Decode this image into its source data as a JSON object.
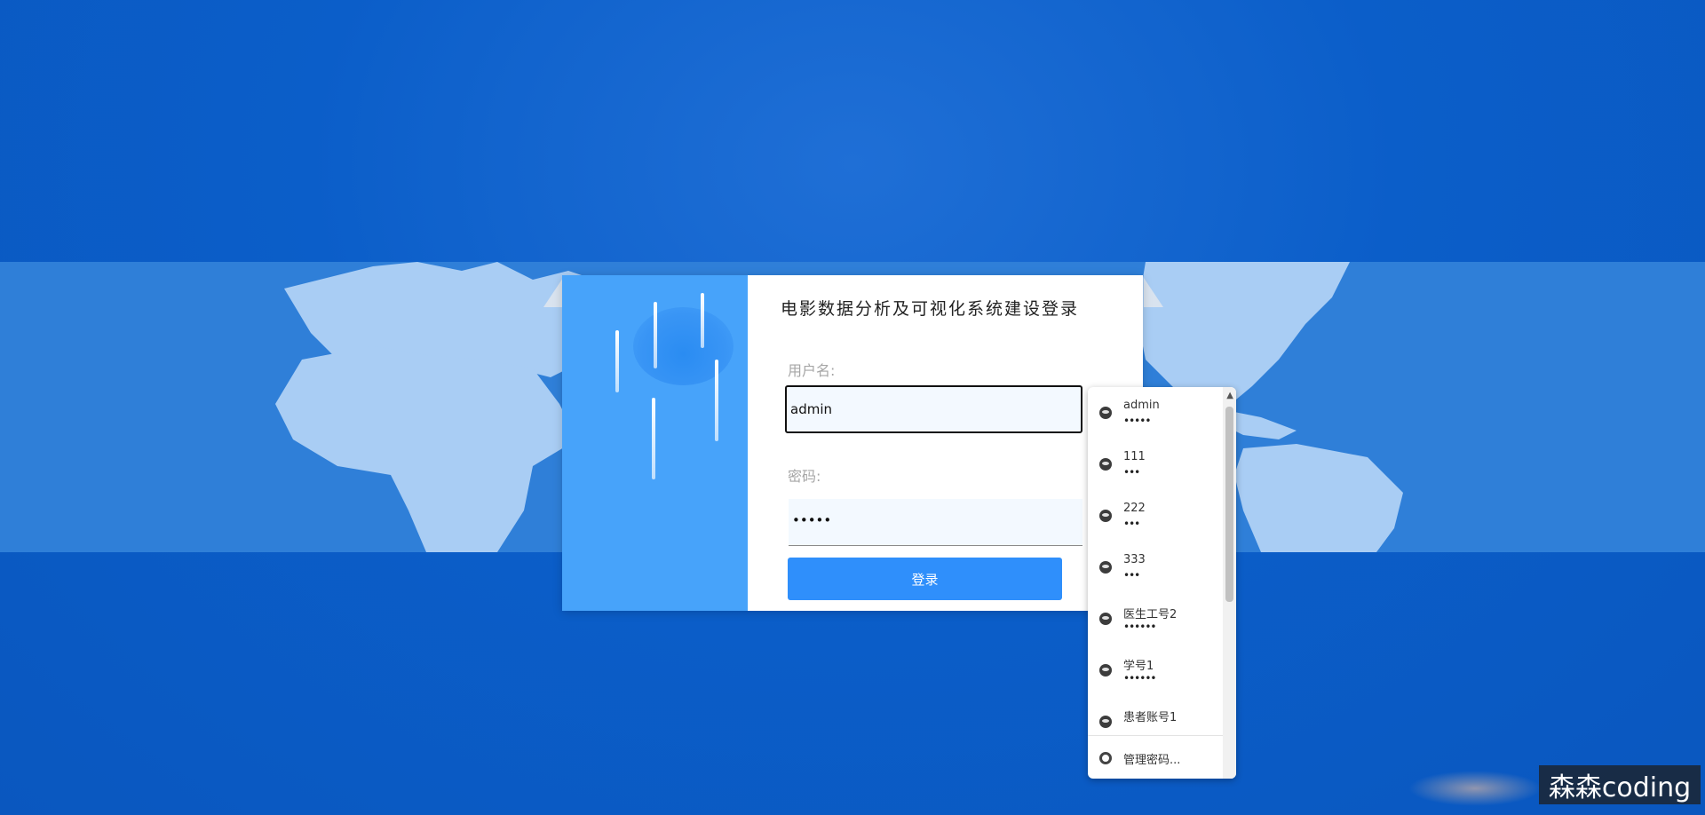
{
  "login": {
    "title": "电影数据分析及可视化系统建设登录",
    "username_label": "用户名:",
    "username_value": "admin",
    "password_label": "密码:",
    "password_value": "•••••",
    "login_button": "登录"
  },
  "autofill": {
    "items": [
      {
        "user": "admin",
        "pass": "•••••"
      },
      {
        "user": "111",
        "pass": "•••"
      },
      {
        "user": "222",
        "pass": "•••"
      },
      {
        "user": "333",
        "pass": "•••"
      },
      {
        "user": "医生工号2",
        "pass": "••••••"
      },
      {
        "user": "学号1",
        "pass": "••••••"
      },
      {
        "user": "患者账号1",
        "pass": ""
      }
    ],
    "manage_label": "管理密码..."
  },
  "watermark": "森森coding",
  "colors": {
    "background": "#0b5ec9",
    "map_band": "#2f7fd8",
    "card_left": "#47a3fa",
    "button": "#2f8ffb"
  }
}
